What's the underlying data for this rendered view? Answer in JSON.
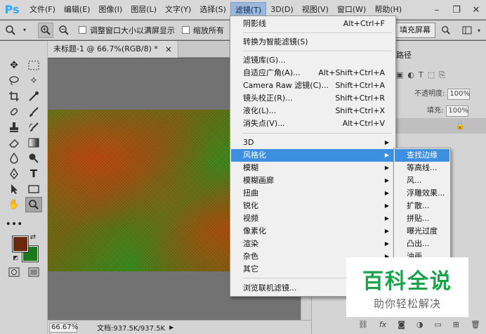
{
  "app": {
    "logo": "Ps"
  },
  "menubar": {
    "items": [
      "文件(F)",
      "编辑(E)",
      "图像(I)",
      "图层(L)",
      "文字(Y)",
      "选择(S)",
      "滤镜(T)",
      "3D(D)",
      "视图(V)",
      "窗口(W)",
      "帮助(H)"
    ],
    "active_index": 6
  },
  "optionsbar": {
    "resize_windows_label": "调整窗口大小以满屏显示",
    "zoom_all_label": "缩放所有",
    "fill_screen_label": "填充屏幕"
  },
  "document": {
    "tab_title": "未标题-1 @ 66.7%(RGB/8) *",
    "close_glyph": "×"
  },
  "statusbar": {
    "zoom": "66.67%",
    "doc_size": "文档:937.5K/937.5K"
  },
  "right_panel": {
    "tab_label": "路径",
    "opacity_label": "不透明度:",
    "opacity_value": "100%",
    "fill_label": "填充:",
    "fill_value": "100%"
  },
  "filter_menu": {
    "items": [
      {
        "label": "阴影线",
        "shortcut": "Alt+Ctrl+F"
      },
      {
        "label": "转换为智能滤镜(S)",
        "shortcut": ""
      },
      {
        "label": "滤镜库(G)...",
        "shortcut": ""
      },
      {
        "label": "自适应广角(A)...",
        "shortcut": "Alt+Shift+Ctrl+A"
      },
      {
        "label": "Camera Raw 滤镜(C)...",
        "shortcut": "Shift+Ctrl+A"
      },
      {
        "label": "镜头校正(R)...",
        "shortcut": "Shift+Ctrl+R"
      },
      {
        "label": "液化(L)...",
        "shortcut": "Shift+Ctrl+X"
      },
      {
        "label": "消失点(V)...",
        "shortcut": "Alt+Ctrl+V"
      },
      {
        "label": "3D",
        "shortcut": ""
      },
      {
        "label": "风格化",
        "shortcut": ""
      },
      {
        "label": "模糊",
        "shortcut": ""
      },
      {
        "label": "模糊画廊",
        "shortcut": ""
      },
      {
        "label": "扭曲",
        "shortcut": ""
      },
      {
        "label": "锐化",
        "shortcut": ""
      },
      {
        "label": "视频",
        "shortcut": ""
      },
      {
        "label": "像素化",
        "shortcut": ""
      },
      {
        "label": "渲染",
        "shortcut": ""
      },
      {
        "label": "杂色",
        "shortcut": ""
      },
      {
        "label": "其它",
        "shortcut": ""
      },
      {
        "label": "浏览联机滤镜...",
        "shortcut": ""
      }
    ],
    "highlighted": "风格化"
  },
  "stylize_submenu": {
    "items": [
      "查找边缘",
      "等高线...",
      "风...",
      "浮雕效果...",
      "扩散...",
      "拼贴...",
      "曝光过度",
      "凸出...",
      "油画..."
    ],
    "highlighted": "查找边缘"
  },
  "watermark": {
    "title": "百科全说",
    "subtitle": "助你轻松解决"
  },
  "colors": {
    "foreground": "#6b2a0e",
    "background": "#1a7a1a",
    "menu_highlight": "#3d8fe0"
  }
}
